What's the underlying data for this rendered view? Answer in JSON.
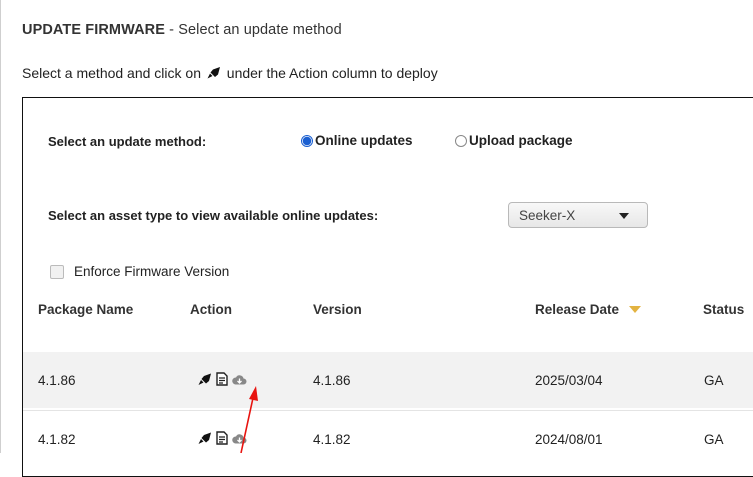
{
  "page": {
    "title": "UPDATE FIRMWARE",
    "title_sep": " - ",
    "subtitle": "Select an update method",
    "instruction_before": "Select a method and click on",
    "instruction_after": "under the Action column to deploy"
  },
  "method": {
    "label": "Select an update method:",
    "options": [
      {
        "label": "Online updates",
        "checked": true
      },
      {
        "label": "Upload package",
        "checked": false
      }
    ]
  },
  "asset": {
    "label": "Select an asset type to view available online updates:",
    "selected": "Seeker-X"
  },
  "enforce": {
    "label": "Enforce Firmware Version",
    "checked": false
  },
  "table": {
    "columns": [
      "Package Name",
      "Action",
      "Version",
      "Release Date",
      "Status"
    ],
    "rows": [
      {
        "package": "4.1.86",
        "version": "4.1.86",
        "release_date": "2025/03/04",
        "status": "GA"
      },
      {
        "package": "4.1.82",
        "version": "4.1.82",
        "release_date": "2024/08/01",
        "status": "GA"
      }
    ]
  },
  "colors": {
    "accent": "#1a5fd1",
    "sort_indicator": "#e3b341",
    "annotation_arrow": "#e8130f",
    "row_shade": "#f2f2f2"
  },
  "icons": [
    "rocket-icon",
    "document-icon",
    "cloud-download-icon"
  ]
}
